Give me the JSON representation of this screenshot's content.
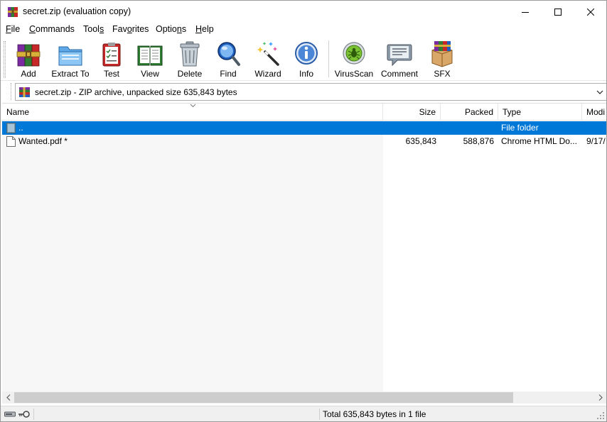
{
  "window": {
    "title": "secret.zip (evaluation copy)",
    "app_icon": "winrar-icon",
    "controls": {
      "minimize": "minimize-icon",
      "maximize": "maximize-icon",
      "close": "close-icon"
    }
  },
  "menu": {
    "items": [
      {
        "label": "File",
        "accel": "F"
      },
      {
        "label": "Commands",
        "accel": "C"
      },
      {
        "label": "Tools",
        "accel": "s"
      },
      {
        "label": "Favorites",
        "accel": "o"
      },
      {
        "label": "Options",
        "accel": "n"
      },
      {
        "label": "Help",
        "accel": "H"
      }
    ]
  },
  "toolbar": {
    "buttons": [
      {
        "label": "Add",
        "icon": "add-archive-icon"
      },
      {
        "label": "Extract To",
        "icon": "extract-folder-icon"
      },
      {
        "label": "Test",
        "icon": "test-clipboard-icon"
      },
      {
        "label": "View",
        "icon": "view-book-icon"
      },
      {
        "label": "Delete",
        "icon": "trash-icon"
      },
      {
        "label": "Find",
        "icon": "magnifier-icon"
      },
      {
        "label": "Wizard",
        "icon": "magic-wand-icon"
      },
      {
        "label": "Info",
        "icon": "info-icon"
      },
      {
        "label": "VirusScan",
        "icon": "virus-scan-icon"
      },
      {
        "label": "Comment",
        "icon": "comment-bubble-icon"
      },
      {
        "label": "SFX",
        "icon": "sfx-box-icon"
      }
    ]
  },
  "path_bar": {
    "text": "secret.zip - ZIP archive, unpacked size 635,843 bytes",
    "icon": "zip-archive-icon"
  },
  "file_list": {
    "columns": [
      "Name",
      "Size",
      "Packed",
      "Type",
      "Modi"
    ],
    "sort_column": "Name",
    "rows": [
      {
        "name": "..",
        "size": "",
        "packed": "",
        "type": "File folder",
        "modified": "",
        "icon": "folder-up-icon",
        "selected": true
      },
      {
        "name": "Wanted.pdf *",
        "size": "635,843",
        "packed": "588,876",
        "type": "Chrome HTML Do...",
        "modified": "9/17/",
        "icon": "document-icon",
        "selected": false
      }
    ]
  },
  "status_bar": {
    "text": "Total 635,843 bytes in 1 file",
    "icons": [
      "drive-icon",
      "key-icon"
    ]
  },
  "colors": {
    "selection": "#0078d7",
    "name_column_bg": "#f7f7f7",
    "scroll_thumb": "#cdcdcd"
  }
}
